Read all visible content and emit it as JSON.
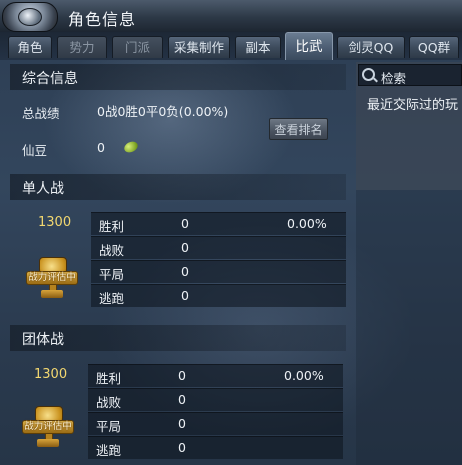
{
  "window": {
    "title": "角色信息"
  },
  "tabs": [
    {
      "label": "角色"
    },
    {
      "label": "势力"
    },
    {
      "label": "门派"
    },
    {
      "label": "采集制作"
    },
    {
      "label": "副本"
    },
    {
      "label": "比武"
    },
    {
      "label": "剑灵QQ"
    },
    {
      "label": "QQ群"
    }
  ],
  "summary": {
    "heading": "综合信息",
    "record_label": "总战绩",
    "record_value": "0战0胜0平0负(0.00%)",
    "bean_label": "仙豆",
    "bean_value": "0",
    "rank_button": "查看排名"
  },
  "solo": {
    "heading": "单人战",
    "score": "1300",
    "badge": "战力评估中",
    "rows": [
      {
        "label": "胜利",
        "count": "0",
        "pct": "0.00%"
      },
      {
        "label": "战败",
        "count": "0",
        "pct": ""
      },
      {
        "label": "平局",
        "count": "0",
        "pct": ""
      },
      {
        "label": "逃跑",
        "count": "0",
        "pct": ""
      }
    ]
  },
  "team": {
    "heading": "团体战",
    "score": "1300",
    "badge": "战力评估中",
    "rows": [
      {
        "label": "胜利",
        "count": "0",
        "pct": "0.00%"
      },
      {
        "label": "战败",
        "count": "0",
        "pct": ""
      },
      {
        "label": "平局",
        "count": "0",
        "pct": ""
      },
      {
        "label": "逃跑",
        "count": "0",
        "pct": ""
      }
    ]
  },
  "side": {
    "search_label": "检索",
    "recent_text": "最近交际过的玩"
  }
}
